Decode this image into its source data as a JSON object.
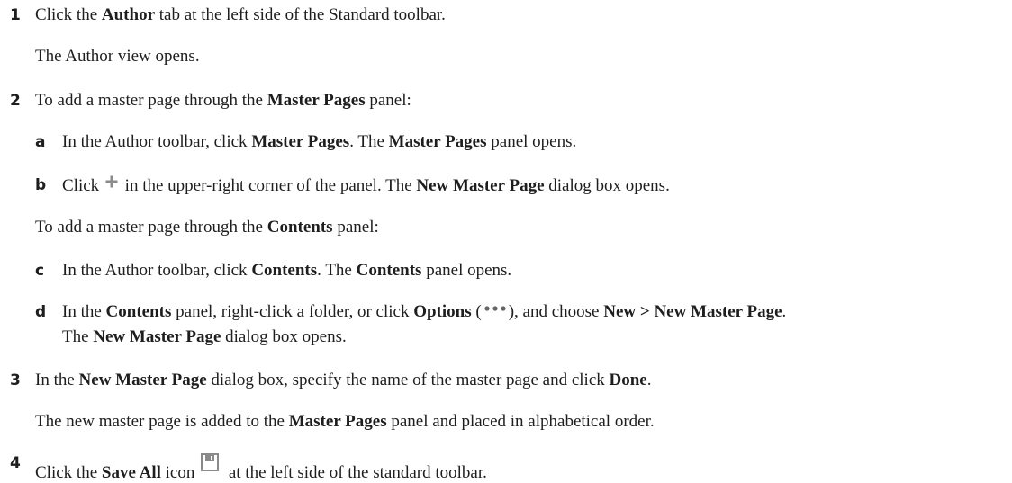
{
  "steps": [
    {
      "num": "1",
      "text": [
        "Click the ",
        "Author",
        " tab at the left side of the Standard toolbar."
      ],
      "result": "The Author view opens."
    },
    {
      "num": "2",
      "text": [
        "To add a master page through the ",
        "Master Pages",
        " panel:"
      ],
      "substeps": [
        {
          "letter": "a",
          "text": [
            "In the Author toolbar, click ",
            "Master Pages",
            ". The ",
            "Master Pages",
            " panel opens."
          ]
        },
        {
          "letter": "b",
          "text": [
            "Click ",
            " in the upper-right corner of the panel.  The ",
            "New Master Page",
            " dialog box opens."
          ],
          "icon": "plus-icon"
        }
      ],
      "alt_intro": [
        "To add a master page through the ",
        "Contents",
        " panel:"
      ],
      "substeps2": [
        {
          "letter": "c",
          "text": [
            "In the Author toolbar, click ",
            "Contents",
            ". The ",
            "Contents",
            " panel opens."
          ]
        },
        {
          "letter": "d",
          "text": [
            "In the ",
            "Contents",
            " panel, right-click a folder, or click ",
            "Options",
            " (",
            "), and choose ",
            "New > New Master Page",
            "."
          ],
          "text_line2": [
            "The ",
            "New Master Page",
            " dialog box opens."
          ],
          "icon": "more-options-icon"
        }
      ]
    },
    {
      "num": "3",
      "text": [
        "In the ",
        "New Master Page",
        " dialog box, specify the name of the master page and click ",
        "Done",
        "."
      ],
      "result": [
        "The new master page is added to the ",
        "Master Pages",
        " panel and placed in alphabetical order."
      ]
    },
    {
      "num": "4",
      "text": [
        "Click the ",
        "Save All",
        " icon ",
        " at the left side of the standard toolbar."
      ],
      "icon": "save-icon"
    }
  ],
  "colors": {
    "text": "#1e1e1e",
    "icon_gray": "#8a8a8a"
  }
}
